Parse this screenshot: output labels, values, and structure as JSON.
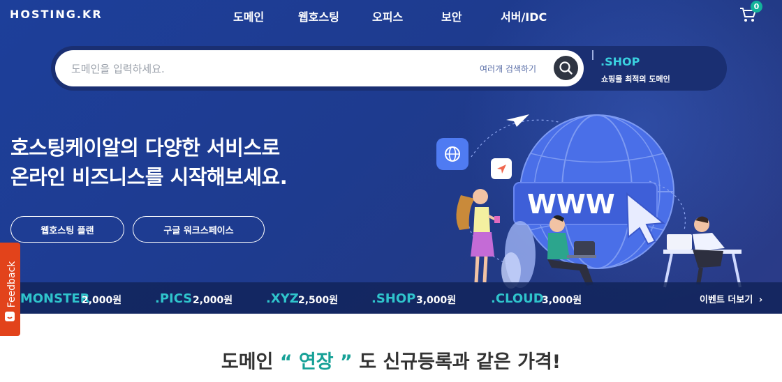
{
  "header": {
    "logo": "HOSTING.KR",
    "nav": [
      "도메인",
      "웹호스팅",
      "오피스",
      "보안",
      "서버/IDC"
    ],
    "cart_count": "0"
  },
  "search": {
    "placeholder": "도메인을 입력하세요.",
    "multi_search_label": "여러개 검색하기"
  },
  "promo": {
    "tld": ".SHOP",
    "desc": "쇼핑몰 최적의 도메인"
  },
  "hero": {
    "line1": "호스팅케이알의 다양한 서비스로",
    "line2": "온라인 비즈니스를 시작해보세요.",
    "cta1": "웹호스팅 플랜",
    "cta2": "구글 워크스페이스",
    "illustration_text": "WWW"
  },
  "ticker": {
    "items": [
      {
        "tld": ".MONSTER",
        "price": "2,000원"
      },
      {
        "tld": ".PICS",
        "price": "2,000원"
      },
      {
        "tld": ".XYZ",
        "price": "2,500원"
      },
      {
        "tld": ".SHOP",
        "price": "3,000원"
      },
      {
        "tld": ".CLOUD",
        "price": "3,000원"
      }
    ],
    "event_link": "이벤트 더보기"
  },
  "feedback": {
    "label": "Feedback"
  },
  "bottom": {
    "prefix": "도메인",
    "highlight": "“ 연장 ”",
    "suffix": "도 신규등록과 같은 가격!"
  },
  "colors": {
    "accent_teal": "#17a197",
    "tld_cyan": "#2fc4cc",
    "hero_blue": "#1e3b8f",
    "feedback_orange": "#e2431b"
  }
}
